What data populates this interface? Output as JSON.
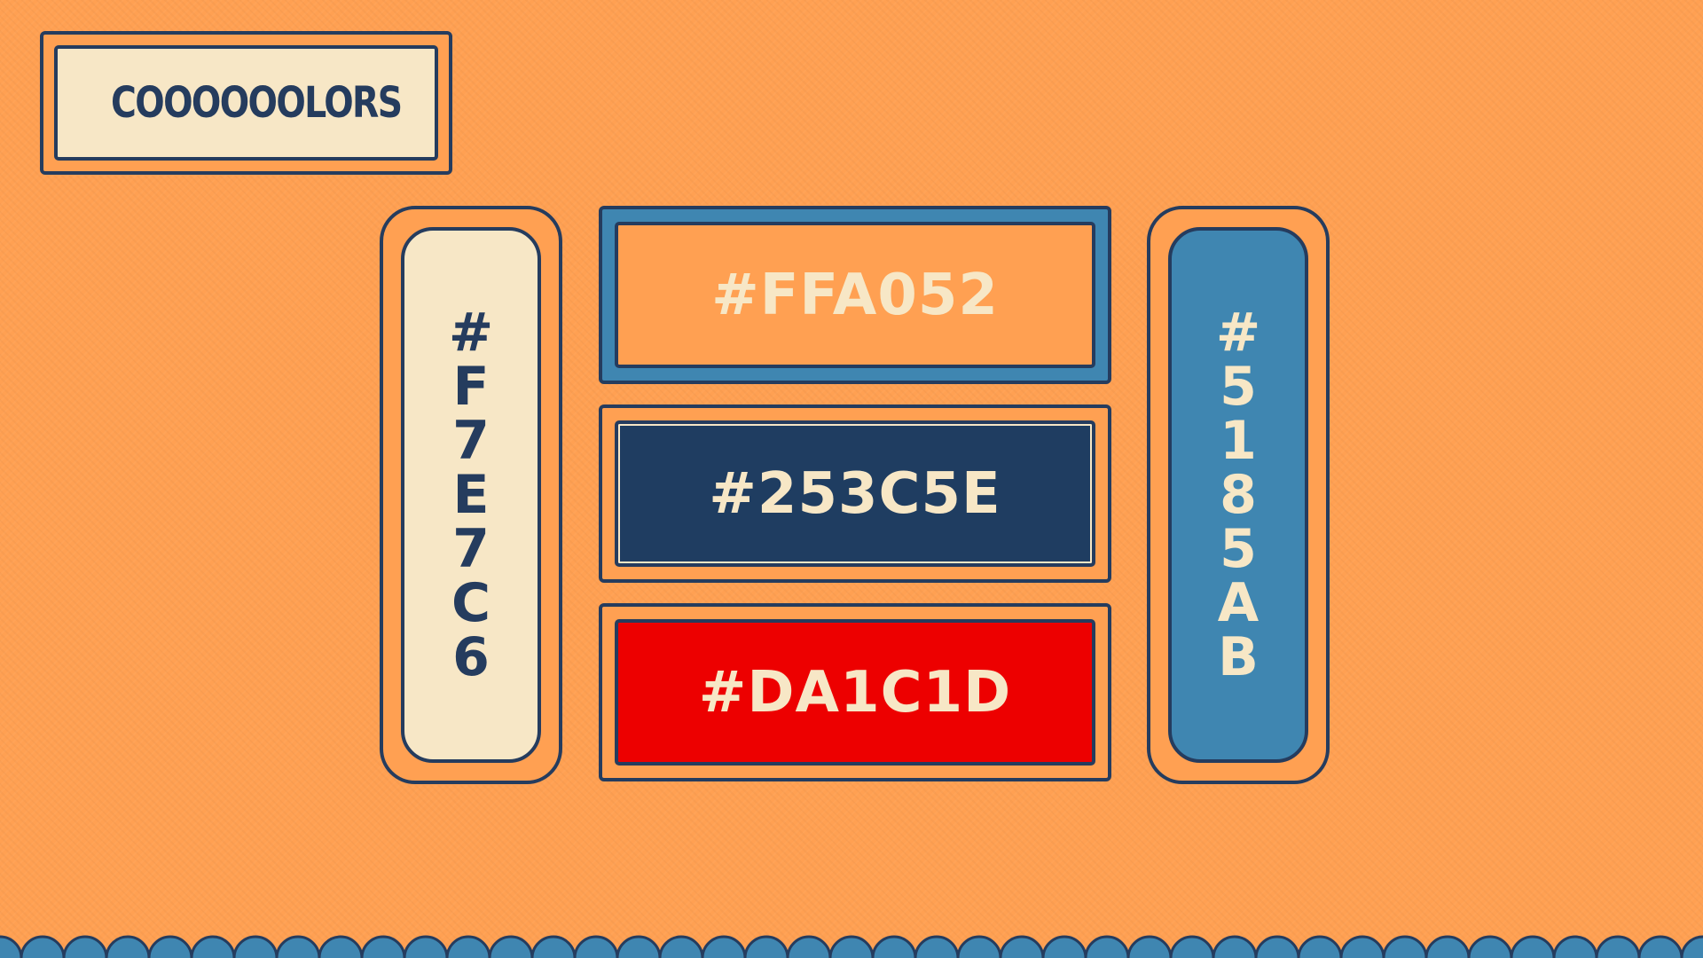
{
  "title": "COOOOOOLORS",
  "swatches": {
    "cream": {
      "label": "#F7E7C6",
      "chars": [
        "#",
        "F",
        "7",
        "E",
        "7",
        "C",
        "6"
      ],
      "color": "#f7e7c6"
    },
    "orange": {
      "label": "#FFA052",
      "color": "#ffa052"
    },
    "navy": {
      "label": "#253C5E",
      "color": "#253c5e"
    },
    "red": {
      "label": "#DA1C1D",
      "color": "#da1c1d"
    },
    "blue": {
      "label": "#5185AB",
      "chars": [
        "#",
        "5",
        "1",
        "8",
        "5",
        "A",
        "B"
      ],
      "color": "#5185ab"
    }
  },
  "colors": {
    "background": "#ffa052",
    "outline": "#253c5e",
    "text_light": "#f7e7c6",
    "wave": "#3f86b1"
  }
}
